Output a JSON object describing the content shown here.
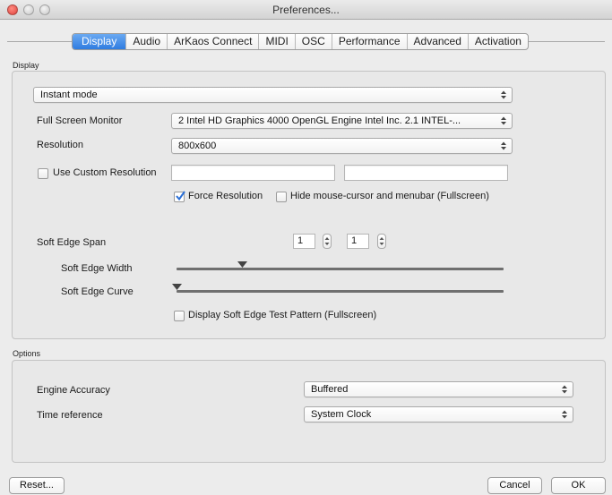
{
  "window": {
    "title": "Preferences..."
  },
  "tabs": [
    {
      "label": "Display",
      "active": true
    },
    {
      "label": "Audio"
    },
    {
      "label": "ArKaos Connect"
    },
    {
      "label": "MIDI"
    },
    {
      "label": "OSC"
    },
    {
      "label": "Performance"
    },
    {
      "label": "Advanced"
    },
    {
      "label": "Activation"
    }
  ],
  "display": {
    "group_label": "Display",
    "mode_popup": "Instant mode",
    "full_screen_monitor": {
      "label": "Full Screen Monitor",
      "value": "2 Intel HD Graphics 4000 OpenGL Engine Intel Inc. 2.1 INTEL-..."
    },
    "resolution": {
      "label": "Resolution",
      "value": "800x600"
    },
    "custom_resolution": {
      "label": "Use Custom Resolution",
      "checked": false,
      "width_value": "",
      "height_value": ""
    },
    "force_resolution": {
      "label": "Force Resolution",
      "checked": true
    },
    "hide_cursor": {
      "label": "Hide mouse-cursor and menubar (Fullscreen)",
      "checked": false
    },
    "soft_edge_span": {
      "label": "Soft Edge Span",
      "value1": "1",
      "value2": "1"
    },
    "soft_edge_width": {
      "label": "Soft Edge Width",
      "level": 0.2
    },
    "soft_edge_curve": {
      "label": "Soft Edge Curve",
      "level": 0.0
    },
    "test_pattern": {
      "label": "Display Soft Edge Test Pattern (Fullscreen)",
      "checked": false
    }
  },
  "options": {
    "group_label": "Options",
    "engine_accuracy": {
      "label": "Engine Accuracy",
      "value": "Buffered"
    },
    "time_reference": {
      "label": "Time reference",
      "value": "System Clock"
    }
  },
  "buttons": {
    "reset": "Reset...",
    "cancel": "Cancel",
    "ok": "OK"
  },
  "colors": {
    "accent": "#2f7ce0",
    "check": "#2a6fd6",
    "window_bg": "#ececec"
  }
}
